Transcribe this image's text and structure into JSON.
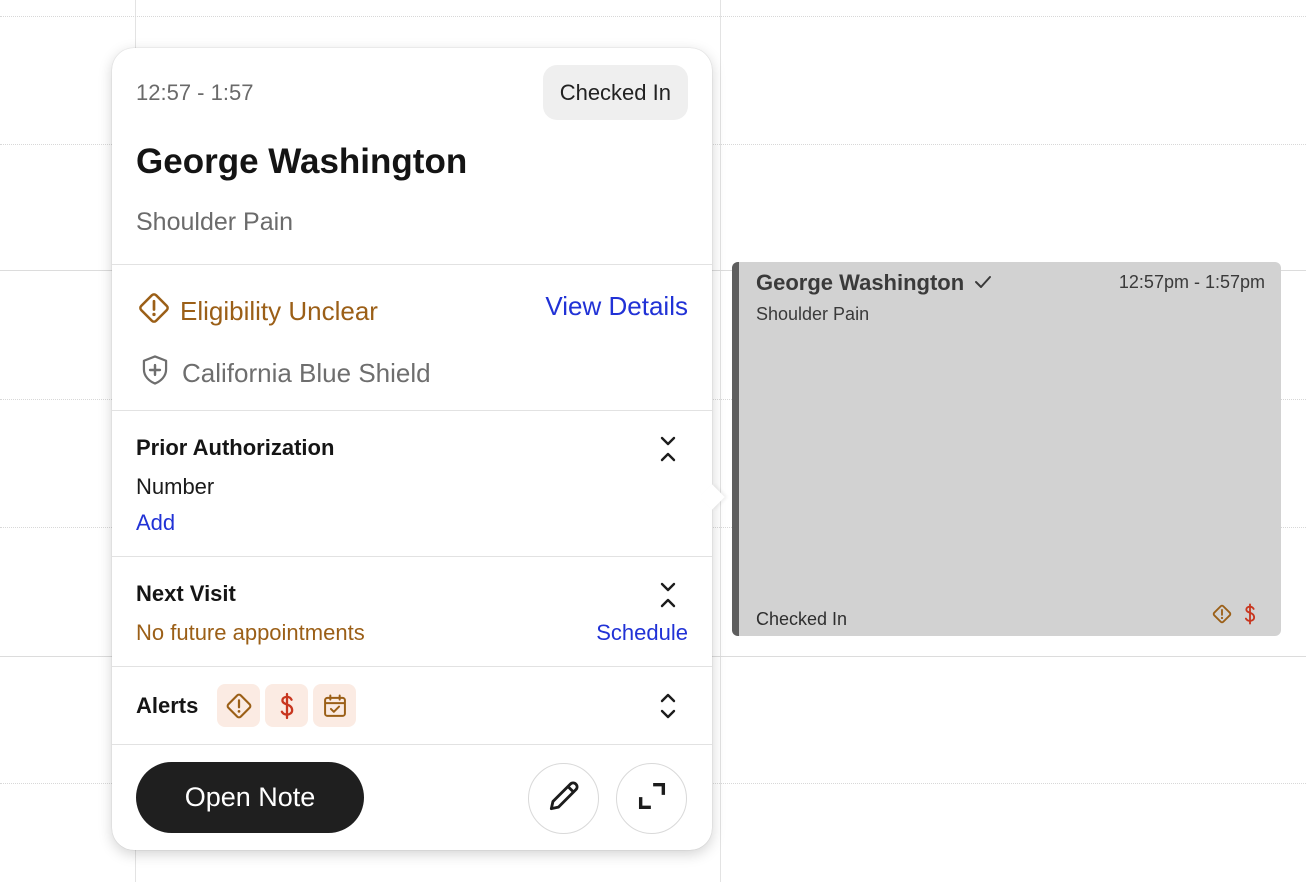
{
  "popover": {
    "time_range": "12:57 - 1:57",
    "status_badge": "Checked In",
    "patient_name": "George Washington",
    "visit_reason": "Shoulder Pain",
    "eligibility_status": "Eligibility Unclear",
    "view_details_label": "View Details",
    "insurance_provider": "California Blue Shield",
    "prior_authorization": {
      "title": "Prior Authorization",
      "field_label": "Number",
      "add_label": "Add"
    },
    "next_visit": {
      "title": "Next Visit",
      "status": "No future appointments",
      "schedule_label": "Schedule"
    },
    "alerts": {
      "title": "Alerts",
      "icons": [
        "eligibility-warning-icon",
        "billing-dollar-icon",
        "calendar-check-icon"
      ]
    },
    "open_note_label": "Open Note"
  },
  "appointment_block": {
    "patient_name": "George Washington",
    "time_range": "12:57pm - 1:57pm",
    "visit_reason": "Shoulder Pain",
    "status": "Checked In",
    "alert_icons": [
      "eligibility-warning-icon",
      "billing-dollar-icon"
    ]
  },
  "colors": {
    "warning": "#9b5f17",
    "link": "#2132d6",
    "billing": "#c8361f",
    "appointment_fill": "#d2d2d2",
    "appointment_bar": "#5e5e5e",
    "primary_button": "#1f1f1f"
  }
}
